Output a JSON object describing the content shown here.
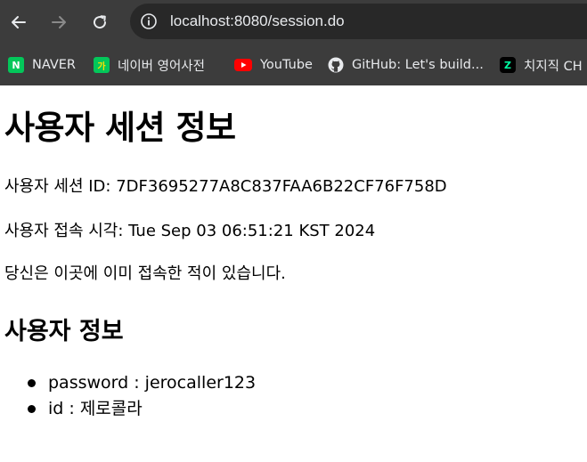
{
  "browser": {
    "url": "localhost:8080/session.do",
    "bookmarks": [
      {
        "label": "NAVER",
        "icon": "naver-icon",
        "color": "#03c75a",
        "glyph": "N"
      },
      {
        "label": "네이버 영어사전",
        "icon": "naver-dictionary-icon",
        "color": "#03c75a",
        "glyph": "가"
      },
      {
        "label": "YouTube",
        "icon": "youtube-icon",
        "color": "#ff0000",
        "glyph": ""
      },
      {
        "label": "GitHub: Let's build...",
        "icon": "github-icon",
        "color": "#ffffff",
        "glyph": ""
      },
      {
        "label": "치지직 CH",
        "icon": "chzzk-icon",
        "color": "#000000",
        "glyph": "Z"
      }
    ]
  },
  "page": {
    "title": "사용자 세션 정보",
    "session_id_line": "사용자 세션 ID: 7DF3695277A8C837FAA6B22CF76F758D",
    "access_time_line": "사용자 접속 시각: Tue Sep 03 06:51:21 KST 2024",
    "visited_line": "당신은 이곳에 이미 접속한 적이 있습니다.",
    "user_info_heading": "사용자 정보",
    "user_info": [
      "password : jerocaller123",
      "id : 제로콜라"
    ]
  }
}
